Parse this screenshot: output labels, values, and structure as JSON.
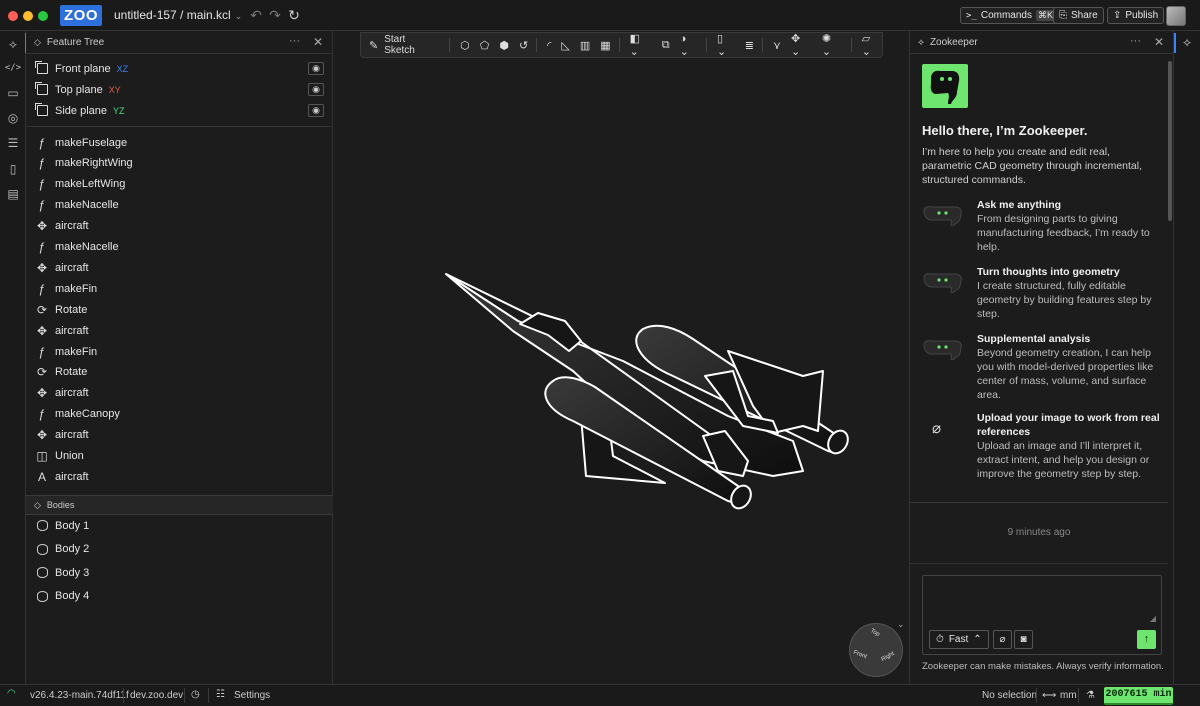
{
  "titlebar": {
    "logo": "ZOO",
    "project": "untitled-157 / main.kcl",
    "commands_label": "Commands",
    "commands_shortcut": "⌘K",
    "share_label": "Share",
    "publish_label": "Publish"
  },
  "feature_tree": {
    "title": "Feature Tree",
    "planes": [
      {
        "label": "Front plane",
        "axis": "XZ",
        "axis_color": "#3b82f6"
      },
      {
        "label": "Top plane",
        "axis": "XY",
        "axis_color": "#e05a4a"
      },
      {
        "label": "Side plane",
        "axis": "YZ",
        "axis_color": "#4ade80"
      }
    ],
    "ops": [
      {
        "label": "makeFuselage",
        "icon": "function-icon"
      },
      {
        "label": "makeRightWing",
        "icon": "function-icon"
      },
      {
        "label": "makeLeftWing",
        "icon": "function-icon"
      },
      {
        "label": "makeNacelle",
        "icon": "function-icon"
      },
      {
        "label": "aircraft",
        "icon": "move-icon"
      },
      {
        "label": "makeNacelle",
        "icon": "function-icon"
      },
      {
        "label": "aircraft",
        "icon": "move-icon"
      },
      {
        "label": "makeFin",
        "icon": "function-icon"
      },
      {
        "label": "Rotate",
        "icon": "rotate-icon"
      },
      {
        "label": "aircraft",
        "icon": "move-icon"
      },
      {
        "label": "makeFin",
        "icon": "function-icon"
      },
      {
        "label": "Rotate",
        "icon": "rotate-icon"
      },
      {
        "label": "aircraft",
        "icon": "move-icon"
      },
      {
        "label": "makeCanopy",
        "icon": "function-icon"
      },
      {
        "label": "aircraft",
        "icon": "move-icon"
      },
      {
        "label": "Union",
        "icon": "union-icon"
      },
      {
        "label": "aircraft",
        "icon": "text-icon"
      }
    ],
    "bodies_title": "Bodies",
    "bodies": [
      "Body 1",
      "Body 2",
      "Body 3",
      "Body 4"
    ]
  },
  "toolbar": {
    "start_sketch": "Start Sketch"
  },
  "zookeeper": {
    "title": "Zookeeper",
    "heading": "Hello there, I’m Zookeeper.",
    "intro": "I’m here to help you create and edit real, parametric CAD geometry through incremental, structured commands.",
    "features": [
      {
        "title": "Ask me anything",
        "desc": "From designing parts to giving manufacturing feedback, I’m ready to help."
      },
      {
        "title": "Turn thoughts into geometry",
        "desc": "I create structured, fully editable geometry by building features step by step."
      },
      {
        "title": "Supplemental analysis",
        "desc": "Beyond geometry creation, I can help you with model-derived properties like center of mass, volume, and surface area."
      },
      {
        "title": "Upload your image to work from real references",
        "desc": "Upload an image and I’ll interpret it, extract intent, and help you design or improve the geometry step by step."
      }
    ],
    "timestamp": "9 minutes ago",
    "mode_label": "Fast",
    "disclaimer": "Zookeeper can make mistakes. Always verify information."
  },
  "view_cube": {
    "top": "Top",
    "front": "Front",
    "right": "Right"
  },
  "status": {
    "version": "v26.4.23-main.74df11f",
    "env": "dev.zoo.dev",
    "settings": "Settings",
    "selection": "No selection",
    "units": "mm",
    "credits": "2007615 min"
  },
  "colors": {
    "accent": "#3b82f6",
    "zoo_green": "#6ee56e",
    "brand_blue": "#2d6fdb"
  }
}
